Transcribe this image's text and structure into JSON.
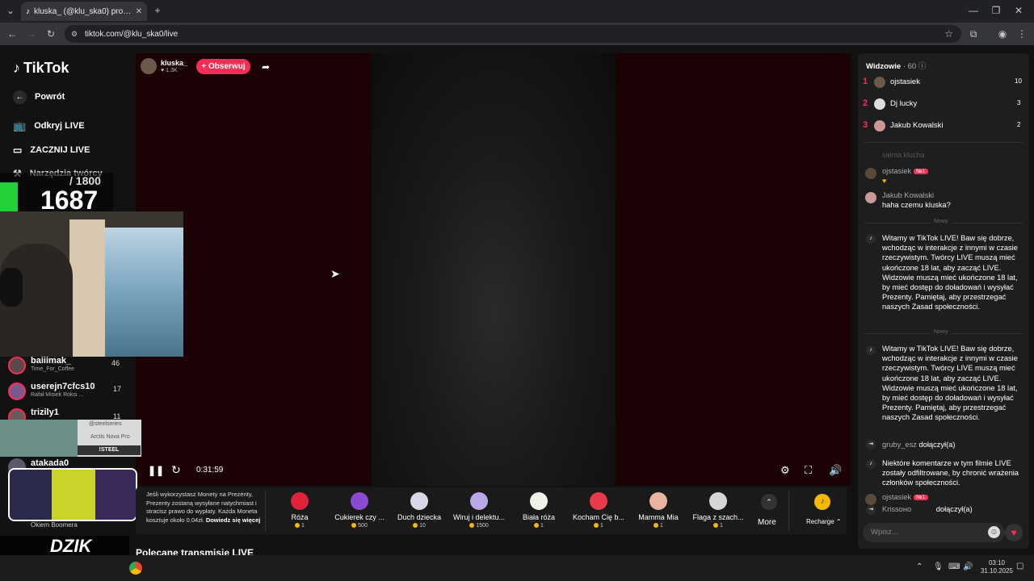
{
  "browser": {
    "tab_title": "kluska_ (@klu_ska0) prowadzi",
    "url": "tiktok.com/@klu_ska0/live"
  },
  "sidebar": {
    "logo": "TikTok",
    "back": "Powrót",
    "items": [
      {
        "label": "Odkryj LIVE"
      },
      {
        "label": "ZACZNIJ LIVE"
      },
      {
        "label": "Narzędzia twórcy"
      }
    ],
    "channels": [
      {
        "name": "baiiimak_",
        "sub": "Time_For_Coffee",
        "count": "46"
      },
      {
        "name": "userejn7cfcs10",
        "sub": "Rafał Misiek Roksi ...",
        "count": "17"
      },
      {
        "name": "trizily1",
        "sub": "",
        "count": "11"
      },
      {
        "name": "atakada0",
        "sub": "",
        "count": ""
      }
    ],
    "bottom_text": "Okiem Boomera"
  },
  "overlay": {
    "counter_total": "/ 1800",
    "counter_value": "1687",
    "ad_line1": "@steelseries",
    "ad_line2": "Arctis Nova Pro",
    "ad_line3": "!STEEL",
    "dzik": "DZIK"
  },
  "streamer": {
    "name": "kluska_",
    "likes": "1.3K",
    "follow_label": "+ Obserwuj"
  },
  "player": {
    "time": "0:31:59"
  },
  "giftbar": {
    "notice": "Jeśli wykorzystasz Monety na Prezenty, Prezenty zostaną wysyłane natychmiast i stracisz prawo do wypłaty. Każda Moneta kosztuje około 0.04zł.",
    "notice_link": "Dowiedz się więcej",
    "gifts": [
      {
        "name": "Róża",
        "price": "1",
        "color": "#e0233a"
      },
      {
        "name": "Cukierek czy ...",
        "price": "500",
        "color": "#8a4bd1"
      },
      {
        "name": "Duch dziecka",
        "price": "10",
        "color": "#d8d8e8"
      },
      {
        "name": "Wiruj i delektu...",
        "price": "1500",
        "color": "#b9a7e8"
      },
      {
        "name": "Biała róża",
        "price": "1",
        "color": "#f0f0e6"
      },
      {
        "name": "Kocham Cię b...",
        "price": "1",
        "color": "#e83a4a"
      },
      {
        "name": "Mamma Mia",
        "price": "1",
        "color": "#e8b4a0"
      },
      {
        "name": "Flaga z szach...",
        "price": "1",
        "color": "#d6d6d6"
      }
    ],
    "more": "More",
    "recharge": "Recharge"
  },
  "page": {
    "recommended": "Polecane transmisje LIVE"
  },
  "chat": {
    "viewers_label": "Widzowie",
    "viewers_count": "· 60",
    "top": [
      {
        "rank": "1",
        "name": "ojstasiek",
        "score": "10"
      },
      {
        "rank": "2",
        "name": "Dj lucky",
        "score": "3"
      },
      {
        "rank": "3",
        "name": "Jakub Kowalski",
        "score": "2"
      }
    ],
    "faded": "siema kluchа",
    "msg1_user": "ojstasiek",
    "msg1_badge": "№1",
    "msg2_user": "Jakub Kowalski",
    "msg2_text": "haha czemu kluska?",
    "new_label": "Nowy",
    "system_text": "Witamy w TikTok LIVE! Baw się dobrze, wchodząc w interakcje z innymi w czasie rzeczywistym. Twórcy LIVE muszą mieć ukończone 18 lat, aby zacząć LIVE. Widzowie muszą mieć ukończone 18 lat, by mieć dostęp do doładowań i wysyłać Prezenty. Pamiętaj, aby przestrzegać naszych Zasad społeczności.",
    "join1_user": "gruby_esz",
    "join_text": "dołączył(a)",
    "filter_text": "Niektóre komentarze w tym filmie LIVE zostały odfiltrowane, by chronić wrażenia członków społeczności.",
    "msg3_user": "ojstasiek",
    "join2_user": "Krissoно",
    "input_placeholder": "Wpisz..."
  },
  "taskbar": {
    "time": "03:10",
    "date": "31.10.2025"
  }
}
